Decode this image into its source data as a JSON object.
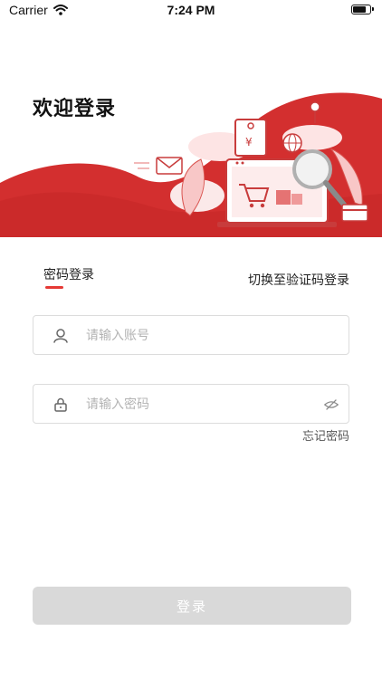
{
  "status_bar": {
    "carrier": "Carrier",
    "time": "7:24 PM",
    "battery_fraction": 0.85
  },
  "welcome": {
    "title": "欢迎登录"
  },
  "tabs": {
    "password_label": "密码登录",
    "switch_label": "切换至验证码登录"
  },
  "form": {
    "account_placeholder": "请输入账号",
    "password_placeholder": "请输入密码",
    "forgot_label": "忘记密码"
  },
  "login_button": {
    "label": "登录"
  },
  "colors": {
    "accent": "#e53935",
    "button_disabled": "#d9d9d9"
  },
  "icons": [
    "wifi-icon",
    "battery-icon",
    "user-icon",
    "lock-icon",
    "eye-off-icon"
  ]
}
